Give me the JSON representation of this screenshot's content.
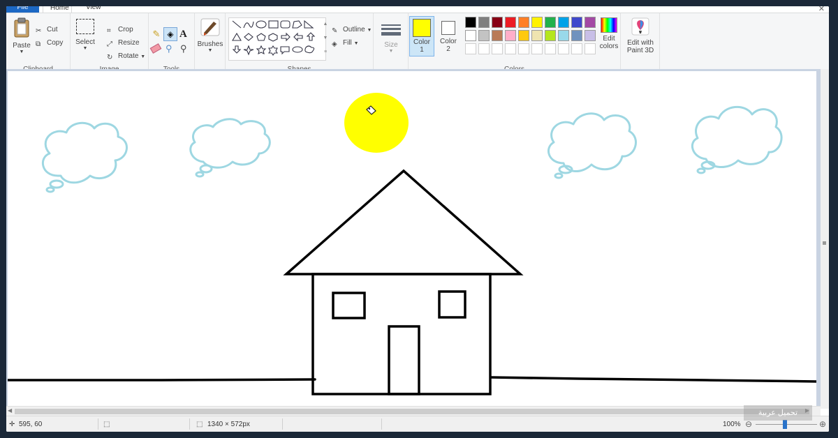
{
  "tabs": {
    "file": "File",
    "home": "Home",
    "view": "View"
  },
  "clipboard": {
    "paste": "Paste",
    "cut": "Cut",
    "copy": "Copy",
    "group": "Clipboard"
  },
  "image": {
    "select": "Select",
    "crop": "Crop",
    "resize": "Resize",
    "rotate": "Rotate",
    "group": "Image"
  },
  "tools": {
    "group": "Tools",
    "text_tool": "A"
  },
  "brushes": {
    "label": "Brushes"
  },
  "shapes": {
    "outline": "Outline",
    "fill": "Fill",
    "group": "Shapes"
  },
  "size": {
    "label": "Size"
  },
  "colors": {
    "color1_label": "Color",
    "color1_num": "1",
    "color2_label": "Color",
    "color2_num": "2",
    "color1_value": "#ffff00",
    "color2_value": "#ffffff",
    "edit_label1": "Edit",
    "edit_label2": "colors",
    "group": "Colors",
    "palette_row1": [
      "#000000",
      "#7f7f7f",
      "#880015",
      "#ed1c24",
      "#ff7f27",
      "#fff200",
      "#22b14c",
      "#00a2e8",
      "#3f48cc",
      "#a349a4"
    ],
    "palette_row2": [
      "#ffffff",
      "#c3c3c3",
      "#b97a57",
      "#ffaec9",
      "#ffc90e",
      "#efe4b0",
      "#b5e61d",
      "#99d9ea",
      "#7092be",
      "#c8bfe7"
    ]
  },
  "paint3d": {
    "label1": "Edit with",
    "label2": "Paint 3D"
  },
  "status": {
    "cursor": "595, 60",
    "dimensions": "1340 × 572px",
    "zoom": "100%"
  },
  "watermark": {
    "text": "تحميل عربية"
  }
}
